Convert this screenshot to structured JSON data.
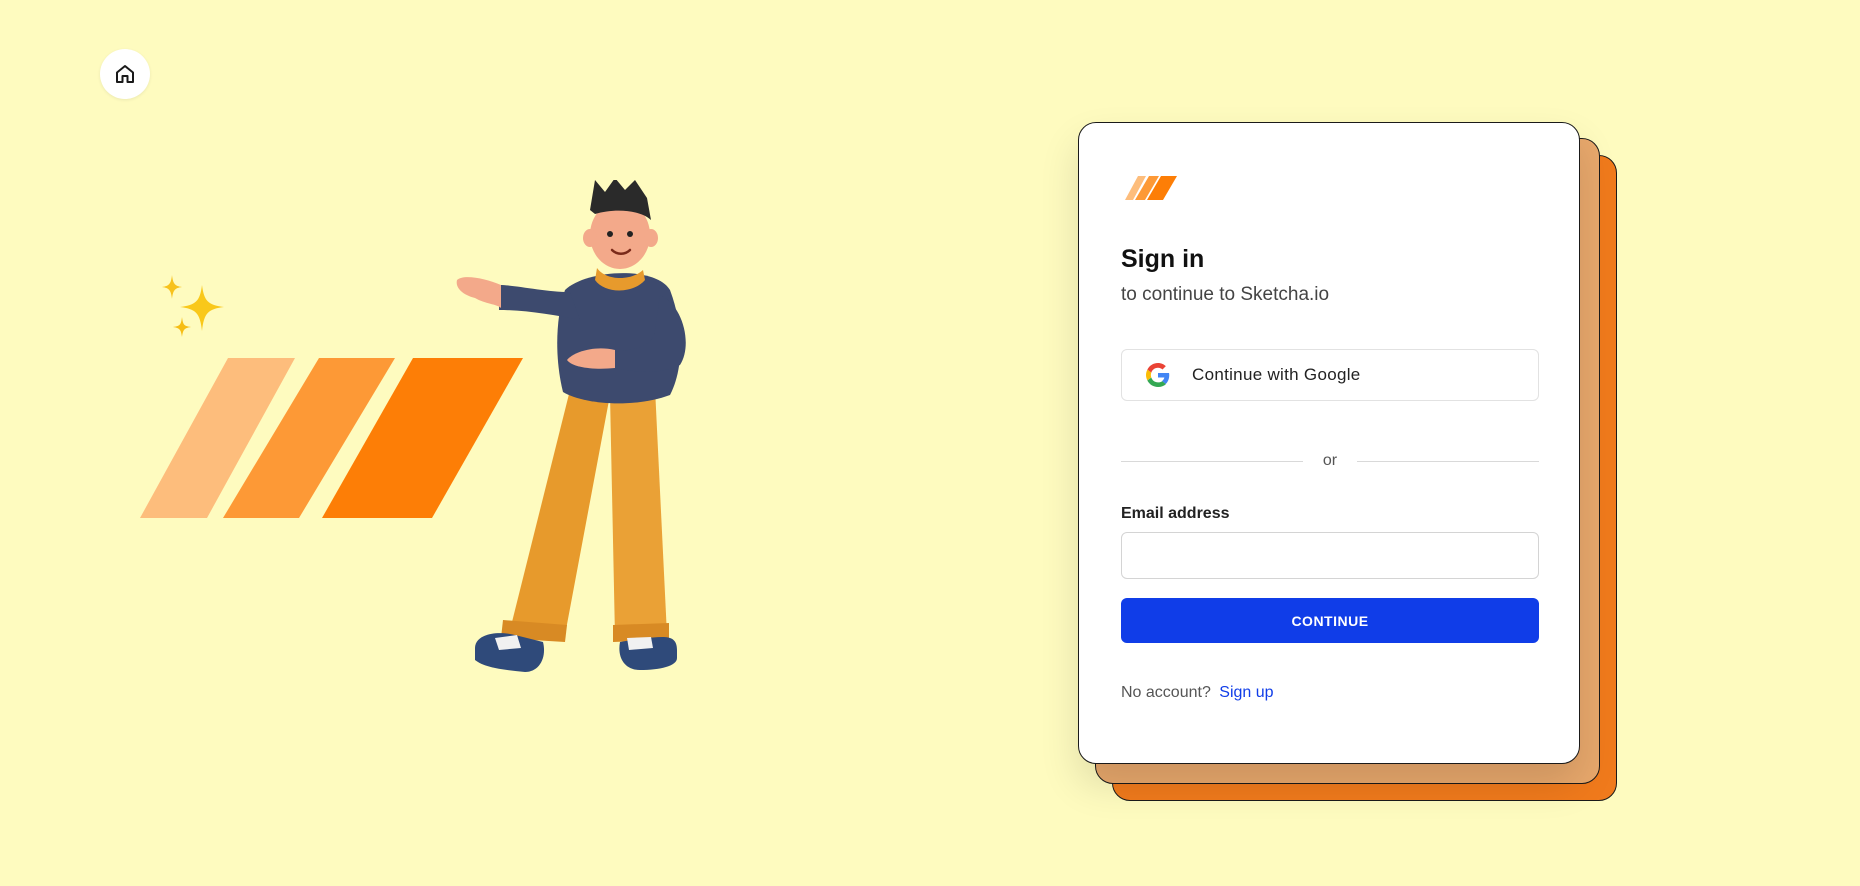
{
  "icons": {
    "home": "home-icon",
    "google": "google-icon",
    "brand_logo": "stripes-logo",
    "sparkles": "sparkles-icon"
  },
  "colors": {
    "background": "#fefbbf",
    "primary_button": "#103de8",
    "link": "#103de8",
    "stripe_light": "#fdbd7c",
    "stripe_mid": "#fd9936",
    "stripe_dark": "#fd7e06",
    "card_back_1": "#e8a86c",
    "card_back_2": "#f07a1c"
  },
  "signin": {
    "title": "Sign in",
    "subtitle": "to continue to Sketcha.io",
    "google_button": "Continue with Google",
    "divider_text": "or",
    "email_label": "Email address",
    "email_value": "",
    "email_placeholder": "",
    "continue_button": "CONTINUE",
    "no_account_text": "No account?",
    "signup_link": "Sign up"
  }
}
